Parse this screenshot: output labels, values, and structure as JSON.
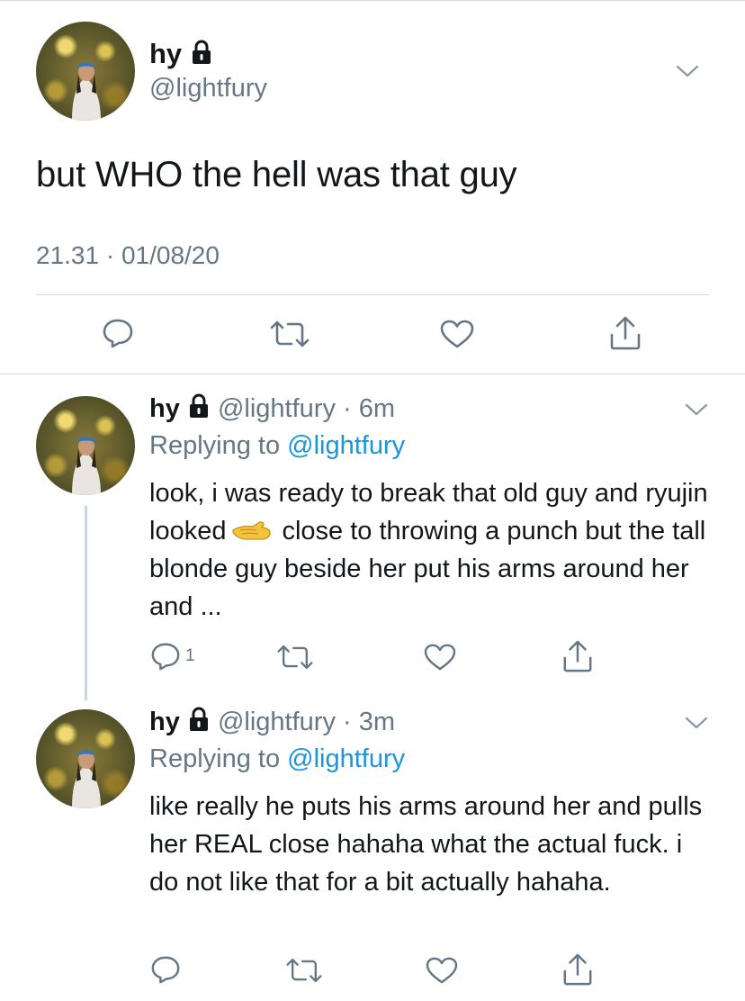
{
  "main_tweet": {
    "display_name": "hy",
    "handle": "@lightfury",
    "text": "but WHO the hell was that guy",
    "timestamp": "21.31 · 01/08/20",
    "actions": [
      "reply-icon",
      "retweet-icon",
      "like-icon",
      "share-icon"
    ]
  },
  "replies": [
    {
      "display_name": "hy",
      "meta": "@lightfury · 6m",
      "replying_prefix": "Replying to ",
      "replying_mention": "@lightfury",
      "text_before_emoji": "look, i was ready to break that old guy and ryujin looked",
      "emoji": "pinching-hand-emoji",
      "text_after_emoji": "close to throwing a punch but the tall blonde guy beside her put his arms around her and ...",
      "reply_count": "1"
    },
    {
      "display_name": "hy",
      "meta": "@lightfury · 3m",
      "replying_prefix": "Replying to ",
      "replying_mention": "@lightfury",
      "text": "like really he puts his arms around her and pulls her REAL close hahaha what the actual fuck. i do not like that for a bit actually hahaha."
    }
  ],
  "colors": {
    "text": "#14171a",
    "secondary": "#657786",
    "link": "#1b95e0",
    "divider": "#d6d9dc",
    "thread_line": "#ccd6dd"
  }
}
